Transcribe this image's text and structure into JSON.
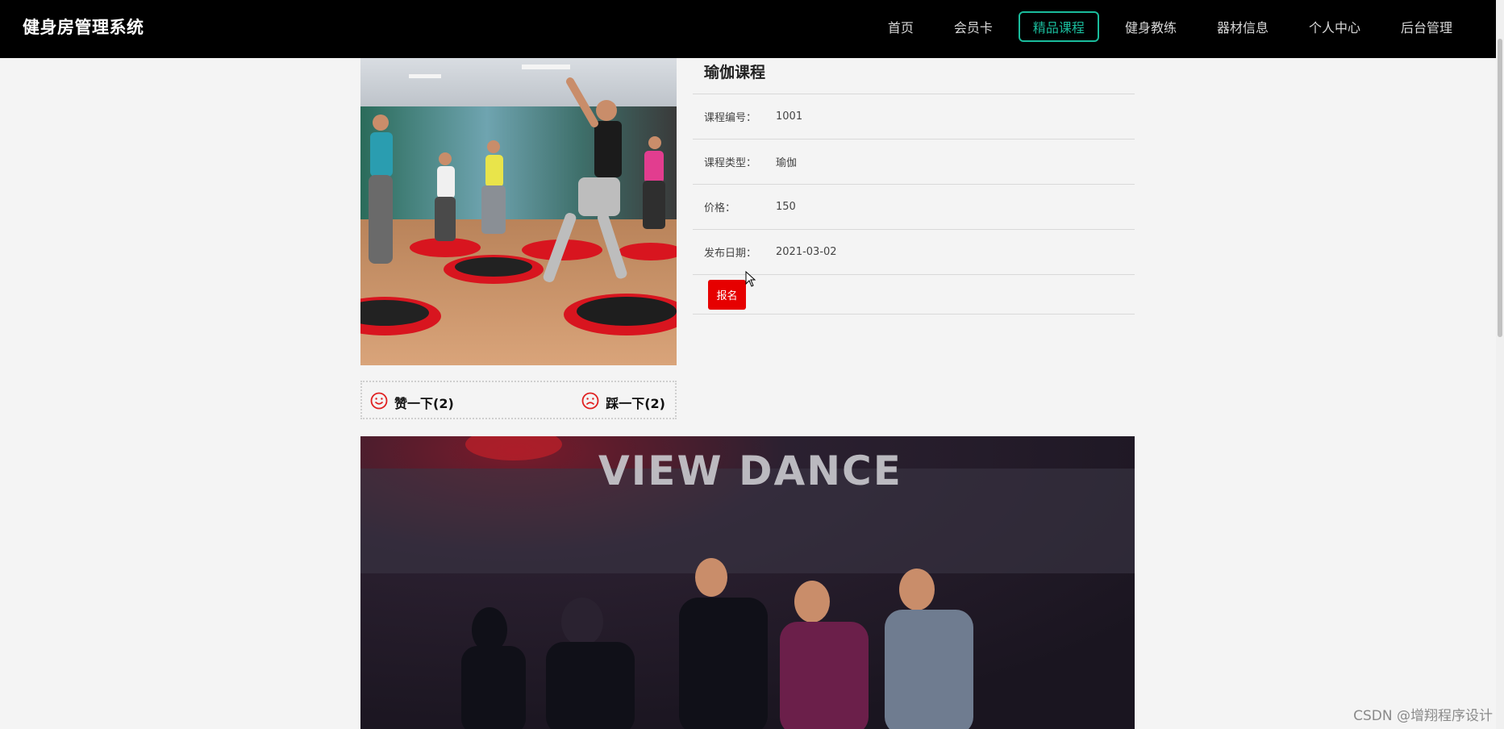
{
  "header": {
    "brand": "健身房管理系统",
    "nav": [
      {
        "label": "首页",
        "active": false
      },
      {
        "label": "会员卡",
        "active": false
      },
      {
        "label": "精品课程",
        "active": true
      },
      {
        "label": "健身教练",
        "active": false
      },
      {
        "label": "器材信息",
        "active": false
      },
      {
        "label": "个人中心",
        "active": false
      },
      {
        "label": "后台管理",
        "active": false
      }
    ]
  },
  "course": {
    "title": "瑜伽课程",
    "fields": [
      {
        "label": "课程编号：",
        "value": "1001"
      },
      {
        "label": "课程类型：",
        "value": "瑜伽"
      },
      {
        "label": "价格：",
        "value": "150"
      },
      {
        "label": "发布日期：",
        "value": "2021-03-02"
      }
    ],
    "signup_label": "报名"
  },
  "votes": {
    "like_label": "赞一下(2)",
    "dislike_label": "踩一下(2)"
  },
  "video": {
    "sign_text": "VIEW DANCE"
  },
  "watermark": "CSDN @增翔程序设计",
  "colors": {
    "header_bg": "#000000",
    "accent": "#1abc9c",
    "signup": "#e60000",
    "vote_icon": "#e02020"
  }
}
